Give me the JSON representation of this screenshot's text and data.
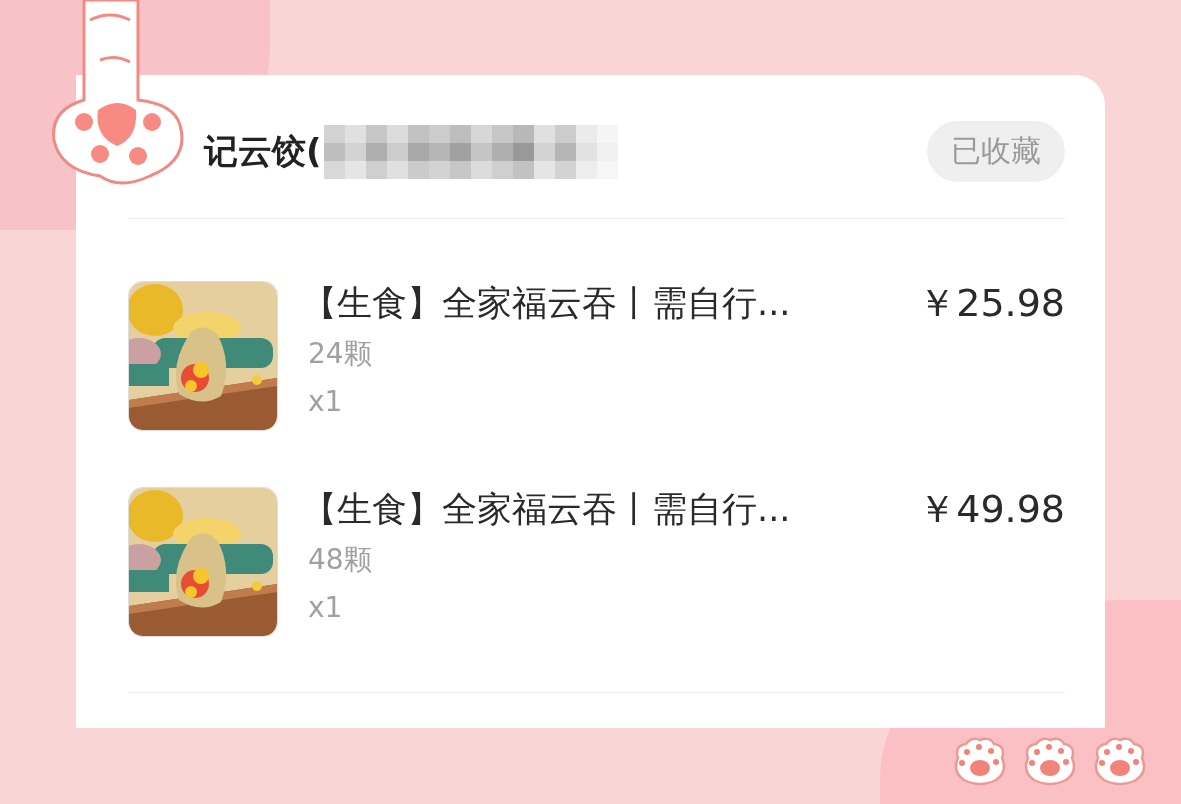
{
  "shop": {
    "name": "记云饺(",
    "favorite_button": "已收藏"
  },
  "items": [
    {
      "title": "【生食】全家福云吞丨需自行...",
      "price": "￥25.98",
      "spec": "24颗",
      "quantity": "x1"
    },
    {
      "title": "【生食】全家福云吞丨需自行...",
      "price": "￥49.98",
      "spec": "48颗",
      "quantity": "x1"
    }
  ]
}
